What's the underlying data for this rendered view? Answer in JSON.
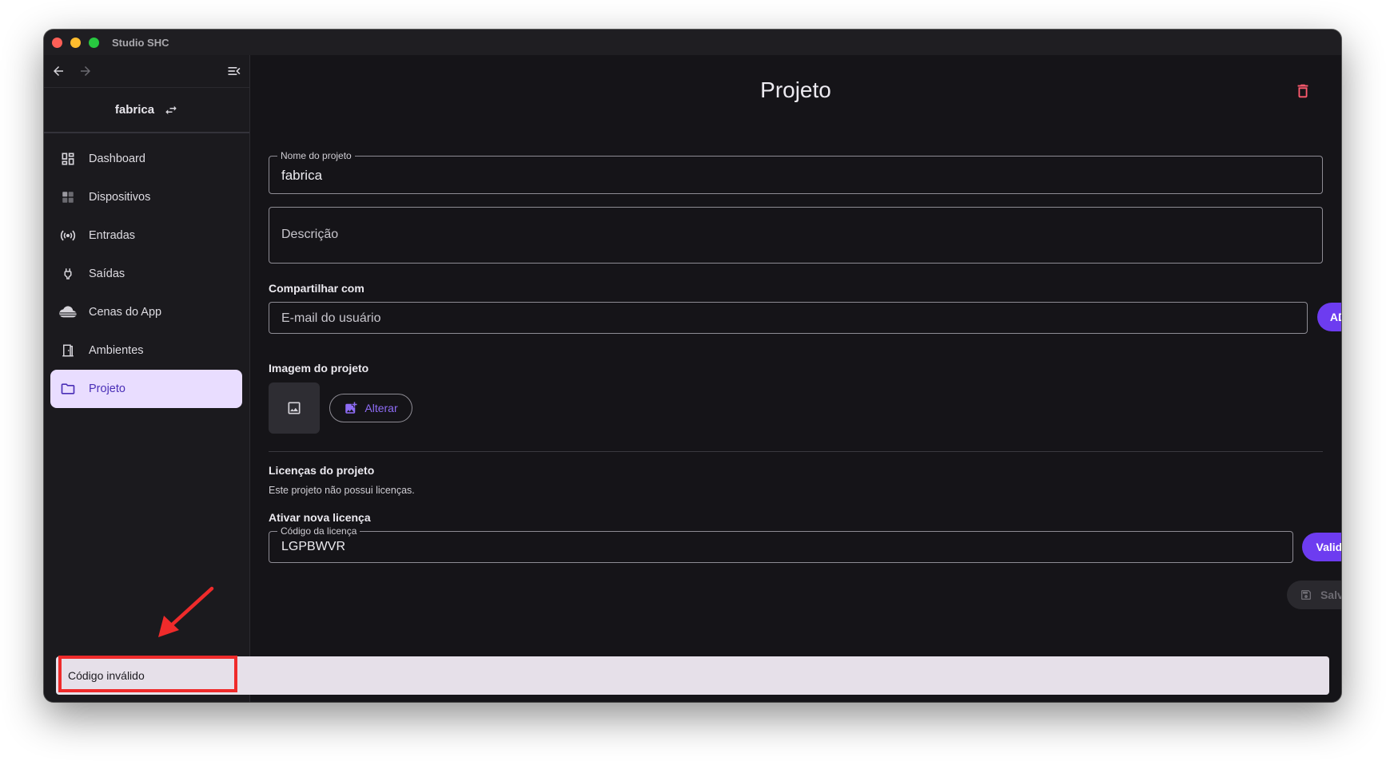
{
  "window": {
    "title": "Studio SHC"
  },
  "sidebar": {
    "project_name": "fabrica",
    "items": [
      {
        "label": "Dashboard",
        "icon": "dashboard-icon"
      },
      {
        "label": "Dispositivos",
        "icon": "devices-icon"
      },
      {
        "label": "Entradas",
        "icon": "broadcast-icon"
      },
      {
        "label": "Saídas",
        "icon": "plug-icon"
      },
      {
        "label": "Cenas do App",
        "icon": "cloud-icon"
      },
      {
        "label": "Ambientes",
        "icon": "door-icon"
      },
      {
        "label": "Projeto",
        "icon": "folder-icon",
        "active": true
      }
    ]
  },
  "main": {
    "title": "Projeto",
    "project_name_label": "Nome do projeto",
    "project_name_value": "fabrica",
    "description_placeholder": "Descrição",
    "share_label": "Compartilhar com",
    "share_placeholder": "E-mail do usuário",
    "add_label": "ADD",
    "image_label": "Imagem do projeto",
    "change_label": "Alterar",
    "licenses_label": "Licenças do projeto",
    "no_licenses_text": "Este projeto não possui licenças.",
    "activate_label": "Ativar nova licença",
    "license_code_label": "Código da licença",
    "license_code_value": "LGPBWVR",
    "validate_label": "Validar",
    "save_label": "Salvar"
  },
  "snackbar": {
    "message": "Código inválido"
  },
  "colors": {
    "accent": "#6d3cf0",
    "active_bg": "#e9ddff",
    "annotation_red": "#ef2b2b",
    "danger": "#ff5a6e"
  }
}
